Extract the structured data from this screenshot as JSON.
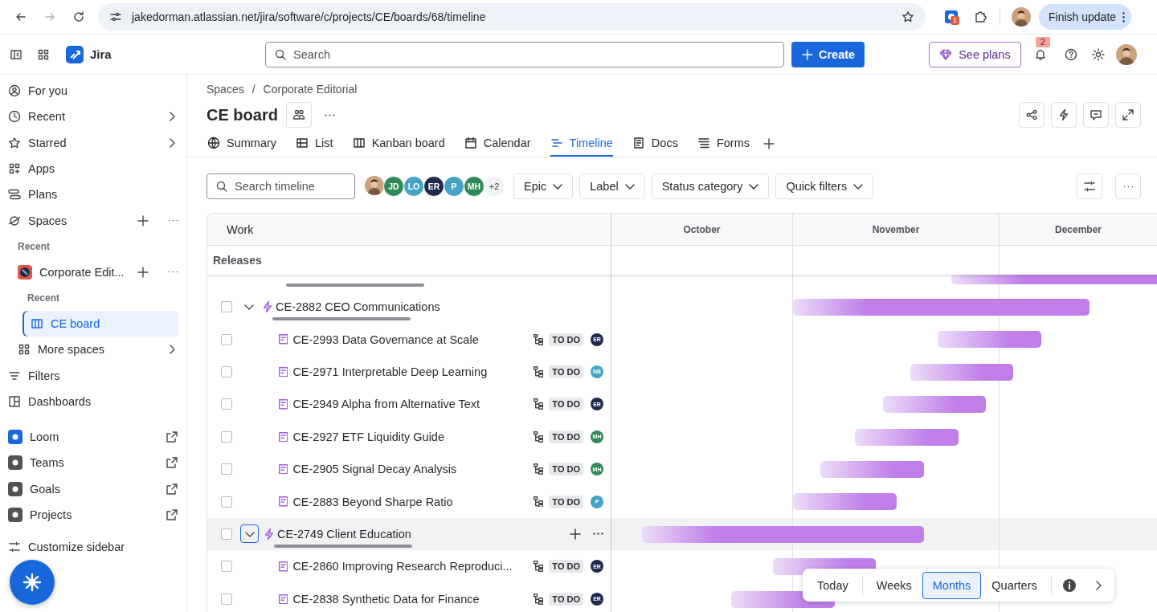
{
  "browser": {
    "back": {
      "disabled": false
    },
    "forward": {
      "disabled": true
    },
    "url": "jakedorman.atlassian.net/jira/software/c/projects/CE/boards/68/timeline",
    "extension_badge": "1",
    "update_button": "Finish update"
  },
  "topbar": {
    "product": "Jira",
    "search_placeholder": "Search",
    "create": "Create",
    "see_plans": "See plans",
    "notifications": "2"
  },
  "sidebar": {
    "primary": [
      {
        "label": "For you",
        "has_submenu": false,
        "has_actions": false
      },
      {
        "label": "Recent",
        "has_submenu": true,
        "has_actions": false
      },
      {
        "label": "Starred",
        "has_submenu": true,
        "has_actions": false
      },
      {
        "label": "Apps",
        "has_submenu": false,
        "has_actions": false
      },
      {
        "label": "Plans",
        "has_submenu": false,
        "has_actions": false
      },
      {
        "label": "Spaces",
        "has_submenu": false,
        "has_actions": true
      }
    ],
    "recent_heading": "Recent",
    "space": {
      "label": "Corporate Edit...",
      "recent_heading": "Recent",
      "boards": [
        {
          "label": "CE board",
          "selected": true
        }
      ]
    },
    "more": [
      {
        "label": "More spaces",
        "has_submenu": true
      },
      {
        "label": "Filters",
        "has_submenu": false
      },
      {
        "label": "Dashboards",
        "has_submenu": false
      }
    ],
    "apps": [
      {
        "label": "Loom",
        "external": true
      },
      {
        "label": "Teams",
        "external": true
      },
      {
        "label": "Goals",
        "external": true
      },
      {
        "label": "Projects",
        "external": true
      }
    ],
    "customize": "Customize sidebar"
  },
  "board": {
    "breadcrumbs": [
      "Spaces",
      "Corporate Editorial"
    ],
    "breadcrumb_separator": "/",
    "title": "CE board",
    "tabs": [
      {
        "label": "Summary",
        "selected": false
      },
      {
        "label": "List",
        "selected": false
      },
      {
        "label": "Kanban board",
        "selected": false
      },
      {
        "label": "Calendar",
        "selected": false
      },
      {
        "label": "Timeline",
        "selected": true
      },
      {
        "label": "Docs",
        "selected": false
      },
      {
        "label": "Forms",
        "selected": false
      }
    ],
    "search_placeholder": "Search timeline",
    "people": [
      {
        "kind": "photo"
      },
      {
        "kind": "initials",
        "initials": "JD",
        "color": "#2f8a57"
      },
      {
        "kind": "initials",
        "initials": "LO",
        "color": "#45a3c4"
      },
      {
        "kind": "initials",
        "initials": "ER",
        "color": "#1d2a4d"
      },
      {
        "kind": "initials",
        "initials": "P",
        "color": "#45a3c4"
      },
      {
        "kind": "initials",
        "initials": "MH",
        "color": "#2f8a57"
      }
    ],
    "people_more": "+2",
    "filters": [
      "Epic",
      "Label",
      "Status category",
      "Quick filters"
    ]
  },
  "table": {
    "work_heading": "Work",
    "months": [
      "October",
      "November",
      "December"
    ],
    "releases": "Releases",
    "rows": [
      {
        "kind": "epic",
        "key": "CE-2882",
        "title": "CEO Communications",
        "checked": false,
        "expanded": true,
        "hovered": false,
        "level": 0
      },
      {
        "kind": "task",
        "key": "CE-2993",
        "title": "Data Governance at Scale",
        "checked": false,
        "hovered": false,
        "status": "TO DO",
        "assignee": "ER",
        "color": "#1d2a4d"
      },
      {
        "kind": "task",
        "key": "CE-2971",
        "title": "Interpretable Deep Learning",
        "checked": false,
        "hovered": false,
        "status": "TO DO",
        "assignee": "NB",
        "color": "#45a3c4"
      },
      {
        "kind": "task",
        "key": "CE-2949",
        "title": "Alpha from Alternative Text",
        "checked": false,
        "hovered": false,
        "status": "TO DO",
        "assignee": "ER",
        "color": "#1d2a4d"
      },
      {
        "kind": "task",
        "key": "CE-2927",
        "title": "ETF Liquidity Guide",
        "checked": false,
        "hovered": false,
        "status": "TO DO",
        "assignee": "MH",
        "color": "#2f8a57"
      },
      {
        "kind": "task",
        "key": "CE-2905",
        "title": "Signal Decay Analysis",
        "checked": false,
        "hovered": false,
        "status": "TO DO",
        "assignee": "MH",
        "color": "#2f8a57"
      },
      {
        "kind": "task",
        "key": "CE-2883",
        "title": "Beyond Sharpe Ratio",
        "checked": false,
        "hovered": false,
        "status": "TO DO",
        "assignee": "P",
        "color": "#45a3c4"
      },
      {
        "kind": "epic",
        "key": "CE-2749",
        "title": "Client Education",
        "checked": false,
        "expanded": true,
        "hovered": true,
        "level": 0
      },
      {
        "kind": "task",
        "key": "CE-2860",
        "title": "Improving Research Reproduci...",
        "checked": false,
        "hovered": false,
        "status": "TO DO",
        "assignee": "ER",
        "color": "#1d2a4d"
      },
      {
        "kind": "task",
        "key": "CE-2838",
        "title": "Synthetic Data for Finance",
        "checked": false,
        "hovered": false,
        "status": "TO DO",
        "assignee": "ER",
        "color": "#1d2a4d"
      }
    ]
  },
  "timescale": [
    {
      "label": "Today",
      "selected": false
    },
    {
      "label": "Weeks",
      "selected": false
    },
    {
      "label": "Months",
      "selected": true
    },
    {
      "label": "Quarters",
      "selected": false
    }
  ]
}
